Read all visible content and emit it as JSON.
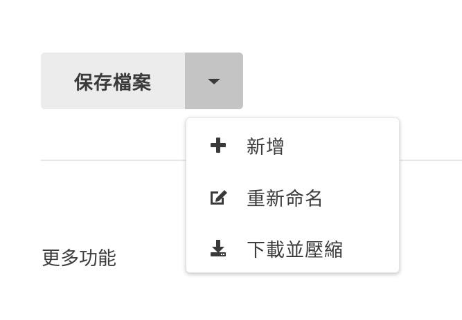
{
  "split_button": {
    "label": "保存檔案",
    "toggle_icon": "caret-down-icon"
  },
  "dropdown_menu": {
    "items": [
      {
        "label": "新增",
        "icon": "plus-icon"
      },
      {
        "label": "重新命名",
        "icon": "edit-icon"
      },
      {
        "label": "下載並壓縮",
        "icon": "download-icon"
      }
    ]
  },
  "section": {
    "more_label": "更多功能"
  }
}
